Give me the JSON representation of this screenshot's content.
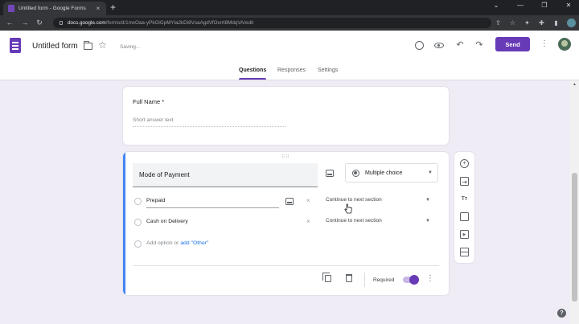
{
  "browser": {
    "tab_title": "Untitled form - Google Forms",
    "tab_close": "×",
    "new_tab": "+",
    "window_controls": [
      "⌄",
      "—",
      "❐",
      "✕"
    ],
    "nav": {
      "back": "←",
      "forward": "→",
      "reload": "↻"
    },
    "url_domain": "docs.google.com",
    "url_path": "/forms/d/1mxOaa-yPkOiGpMYla2kDi8VsaAgdVfOxrrt8MdqVA/edit",
    "icons": [
      "share-icon",
      "star-icon",
      "extensions-icon",
      "puzzle-icon",
      "sidebar-icon",
      "profile-icon",
      "menu-icon"
    ],
    "icon_glyphs": {
      "share": "⇪",
      "star": "☆",
      "extension": "✦",
      "puzzle": "✚",
      "sidebar": "▮",
      "menu": "⋮"
    }
  },
  "header": {
    "title": "Untitled form",
    "status": "Saving...",
    "star_glyph": "☆",
    "undo_glyph": "↶",
    "redo_glyph": "↷",
    "send_label": "Send",
    "more_glyph": "⋮",
    "brand_color": "#673ab7"
  },
  "tabs": [
    {
      "label": "Questions",
      "active": true
    },
    {
      "label": "Responses",
      "active": false
    },
    {
      "label": "Settings",
      "active": false
    }
  ],
  "questions": [
    {
      "title": "Full Name *",
      "placeholder": "Short answer text"
    },
    {
      "title": "Mode of Payment",
      "drag_handle": "⠿⠿",
      "type": "Multiple choice",
      "type_caret": "▼",
      "options": [
        {
          "label": "Prepaid",
          "remove": "×",
          "go_to": "Continue to next section",
          "caret": "▼"
        },
        {
          "label": "Cash on Delivery",
          "remove": "×",
          "go_to": "Continue to next section",
          "caret": "▼"
        }
      ],
      "add_option": "Add option",
      "or": "or",
      "add_other": "add \"Other\"",
      "required_label": "Required",
      "required": true,
      "more_glyph": "⋮"
    }
  ],
  "toolbar": {
    "add_glyph": "+",
    "import_glyph": "⇥",
    "title_glyph": "Tт",
    "image_glyph": "",
    "video_glyph": "▶",
    "section_glyph": ""
  },
  "scroll": {
    "up_glyph": "▲"
  },
  "help_glyph": "?",
  "accent_blue": "#4285f4"
}
